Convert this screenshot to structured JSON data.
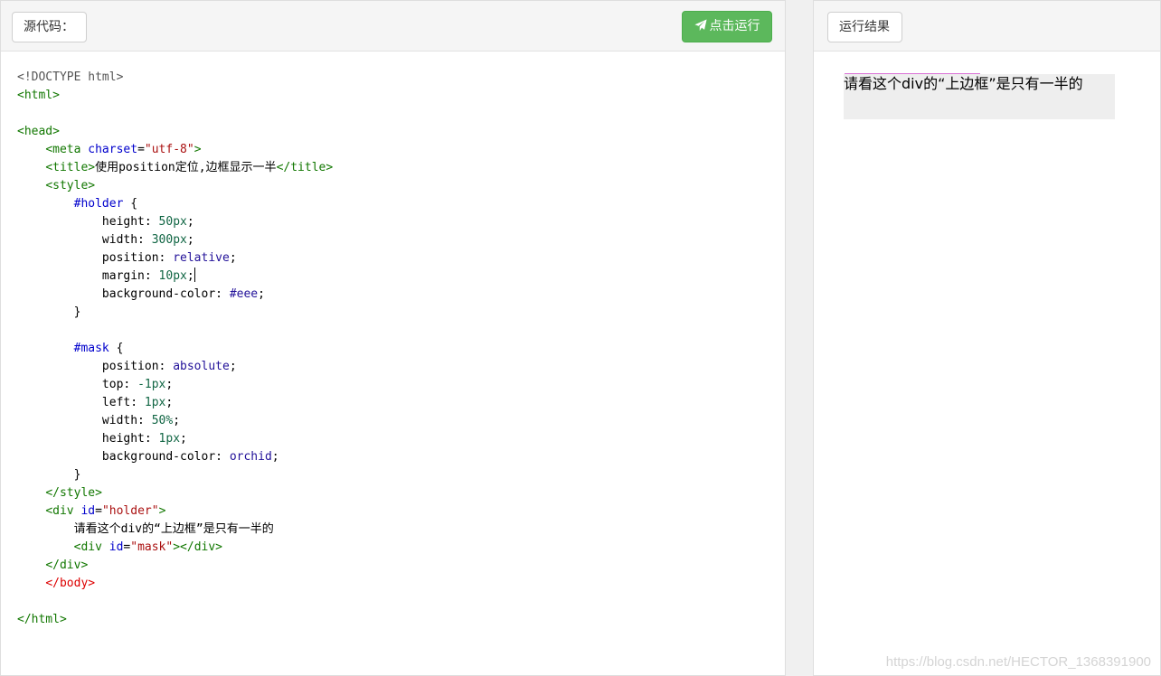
{
  "editor": {
    "source_label": "源代码：",
    "run_label": "点击运行",
    "code_lines": [
      [
        {
          "c": "mt",
          "t": "<!DOCTYPE html>"
        }
      ],
      [
        {
          "c": "tg",
          "t": "<html>"
        }
      ],
      [],
      [
        {
          "c": "tg",
          "t": "<head>"
        }
      ],
      [
        {
          "c": "tx",
          "t": "    "
        },
        {
          "c": "tg",
          "t": "<meta "
        },
        {
          "c": "at",
          "t": "charset"
        },
        {
          "c": "tx",
          "t": "="
        },
        {
          "c": "st",
          "t": "\"utf-8\""
        },
        {
          "c": "tg",
          "t": ">"
        }
      ],
      [
        {
          "c": "tx",
          "t": "    "
        },
        {
          "c": "tg",
          "t": "<title>"
        },
        {
          "c": "tx",
          "t": "使用position定位,边框显示一半"
        },
        {
          "c": "tg",
          "t": "</title>"
        }
      ],
      [
        {
          "c": "tx",
          "t": "    "
        },
        {
          "c": "tg",
          "t": "<style>"
        }
      ],
      [
        {
          "c": "tx",
          "t": "        "
        },
        {
          "c": "sel",
          "t": "#holder"
        },
        {
          "c": "tx",
          "t": " {"
        }
      ],
      [
        {
          "c": "tx",
          "t": "            height: "
        },
        {
          "c": "nm",
          "t": "50px"
        },
        {
          "c": "tx",
          "t": ";"
        }
      ],
      [
        {
          "c": "tx",
          "t": "            width: "
        },
        {
          "c": "nm",
          "t": "300px"
        },
        {
          "c": "tx",
          "t": ";"
        }
      ],
      [
        {
          "c": "tx",
          "t": "            position: "
        },
        {
          "c": "kw",
          "t": "relative"
        },
        {
          "c": "tx",
          "t": ";"
        }
      ],
      [
        {
          "c": "tx",
          "t": "            margin: "
        },
        {
          "c": "nm",
          "t": "10px"
        },
        {
          "c": "tx",
          "t": ";"
        },
        {
          "c": "caret",
          "t": ""
        }
      ],
      [
        {
          "c": "tx",
          "t": "            background-color: "
        },
        {
          "c": "kw",
          "t": "#eee"
        },
        {
          "c": "tx",
          "t": ";"
        }
      ],
      [
        {
          "c": "tx",
          "t": "        }"
        }
      ],
      [],
      [
        {
          "c": "tx",
          "t": "        "
        },
        {
          "c": "sel",
          "t": "#mask"
        },
        {
          "c": "tx",
          "t": " {"
        }
      ],
      [
        {
          "c": "tx",
          "t": "            position: "
        },
        {
          "c": "kw",
          "t": "absolute"
        },
        {
          "c": "tx",
          "t": ";"
        }
      ],
      [
        {
          "c": "tx",
          "t": "            top: "
        },
        {
          "c": "nm",
          "t": "-1px"
        },
        {
          "c": "tx",
          "t": ";"
        }
      ],
      [
        {
          "c": "tx",
          "t": "            left: "
        },
        {
          "c": "nm",
          "t": "1px"
        },
        {
          "c": "tx",
          "t": ";"
        }
      ],
      [
        {
          "c": "tx",
          "t": "            width: "
        },
        {
          "c": "nm",
          "t": "50%"
        },
        {
          "c": "tx",
          "t": ";"
        }
      ],
      [
        {
          "c": "tx",
          "t": "            height: "
        },
        {
          "c": "nm",
          "t": "1px"
        },
        {
          "c": "tx",
          "t": ";"
        }
      ],
      [
        {
          "c": "tx",
          "t": "            background-color: "
        },
        {
          "c": "kw",
          "t": "orchid"
        },
        {
          "c": "tx",
          "t": ";"
        }
      ],
      [
        {
          "c": "tx",
          "t": "        }"
        }
      ],
      [
        {
          "c": "tx",
          "t": "    "
        },
        {
          "c": "tg",
          "t": "</style>"
        }
      ],
      [
        {
          "c": "tx",
          "t": "    "
        },
        {
          "c": "tg",
          "t": "<div "
        },
        {
          "c": "at",
          "t": "id"
        },
        {
          "c": "tx",
          "t": "="
        },
        {
          "c": "st",
          "t": "\"holder\""
        },
        {
          "c": "tg",
          "t": ">"
        }
      ],
      [
        {
          "c": "tx",
          "t": "        请看这个div的“上边框”是只有一半的"
        }
      ],
      [
        {
          "c": "tx",
          "t": "        "
        },
        {
          "c": "tg",
          "t": "<div "
        },
        {
          "c": "at",
          "t": "id"
        },
        {
          "c": "tx",
          "t": "="
        },
        {
          "c": "st",
          "t": "\"mask\""
        },
        {
          "c": "tg",
          "t": "></div>"
        }
      ],
      [
        {
          "c": "tx",
          "t": "    "
        },
        {
          "c": "tg",
          "t": "</div>"
        }
      ],
      [
        {
          "c": "tx",
          "t": "    "
        },
        {
          "c": "rd",
          "t": "</body>"
        }
      ],
      [],
      [
        {
          "c": "tg",
          "t": "</html>"
        }
      ]
    ]
  },
  "result": {
    "label": "运行结果",
    "holder_text": "请看这个div的“上边框”是只有一半的",
    "holder_bg": "#eeeeee",
    "mask_color": "orchid"
  },
  "watermark": "https://blog.csdn.net/HECTOR_1368391900",
  "colors": {
    "run_button": "#5cb85c",
    "tag": "#117700",
    "attribute": "#0000cc",
    "string": "#aa1111",
    "number": "#116644",
    "keyword": "#221199"
  },
  "icons": {
    "run": "paper-plane-icon"
  }
}
